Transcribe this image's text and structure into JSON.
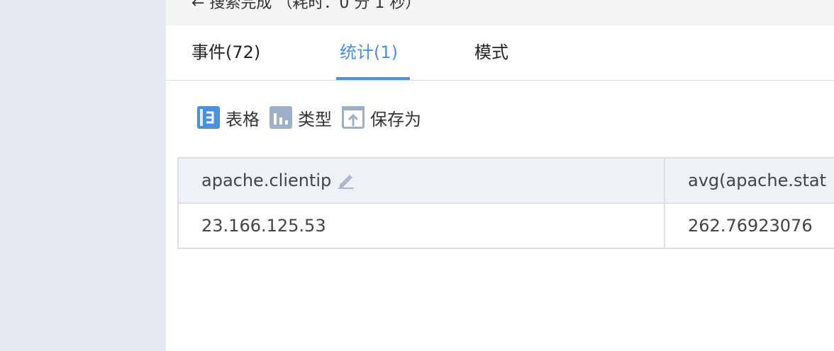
{
  "status": {
    "text": "← 搜索完成 （耗时：0 分 1 秒）"
  },
  "tabs": [
    {
      "label": "事件(72)",
      "active": false
    },
    {
      "label": "统计(1)",
      "active": true
    },
    {
      "label": "模式",
      "active": false
    }
  ],
  "toolbar": {
    "table_label": "表格",
    "type_label": "类型",
    "save_as_label": "保存为"
  },
  "table": {
    "columns": [
      "apache.clientip",
      "avg(apache.stat"
    ],
    "rows": [
      [
        "23.166.125.53",
        "262.76923076"
      ]
    ]
  },
  "colors": {
    "accent": "#4a90e2",
    "sidebar_bg": "#e4e9f2",
    "header_bg": "#eef1f6",
    "border": "#dcdfe6"
  }
}
